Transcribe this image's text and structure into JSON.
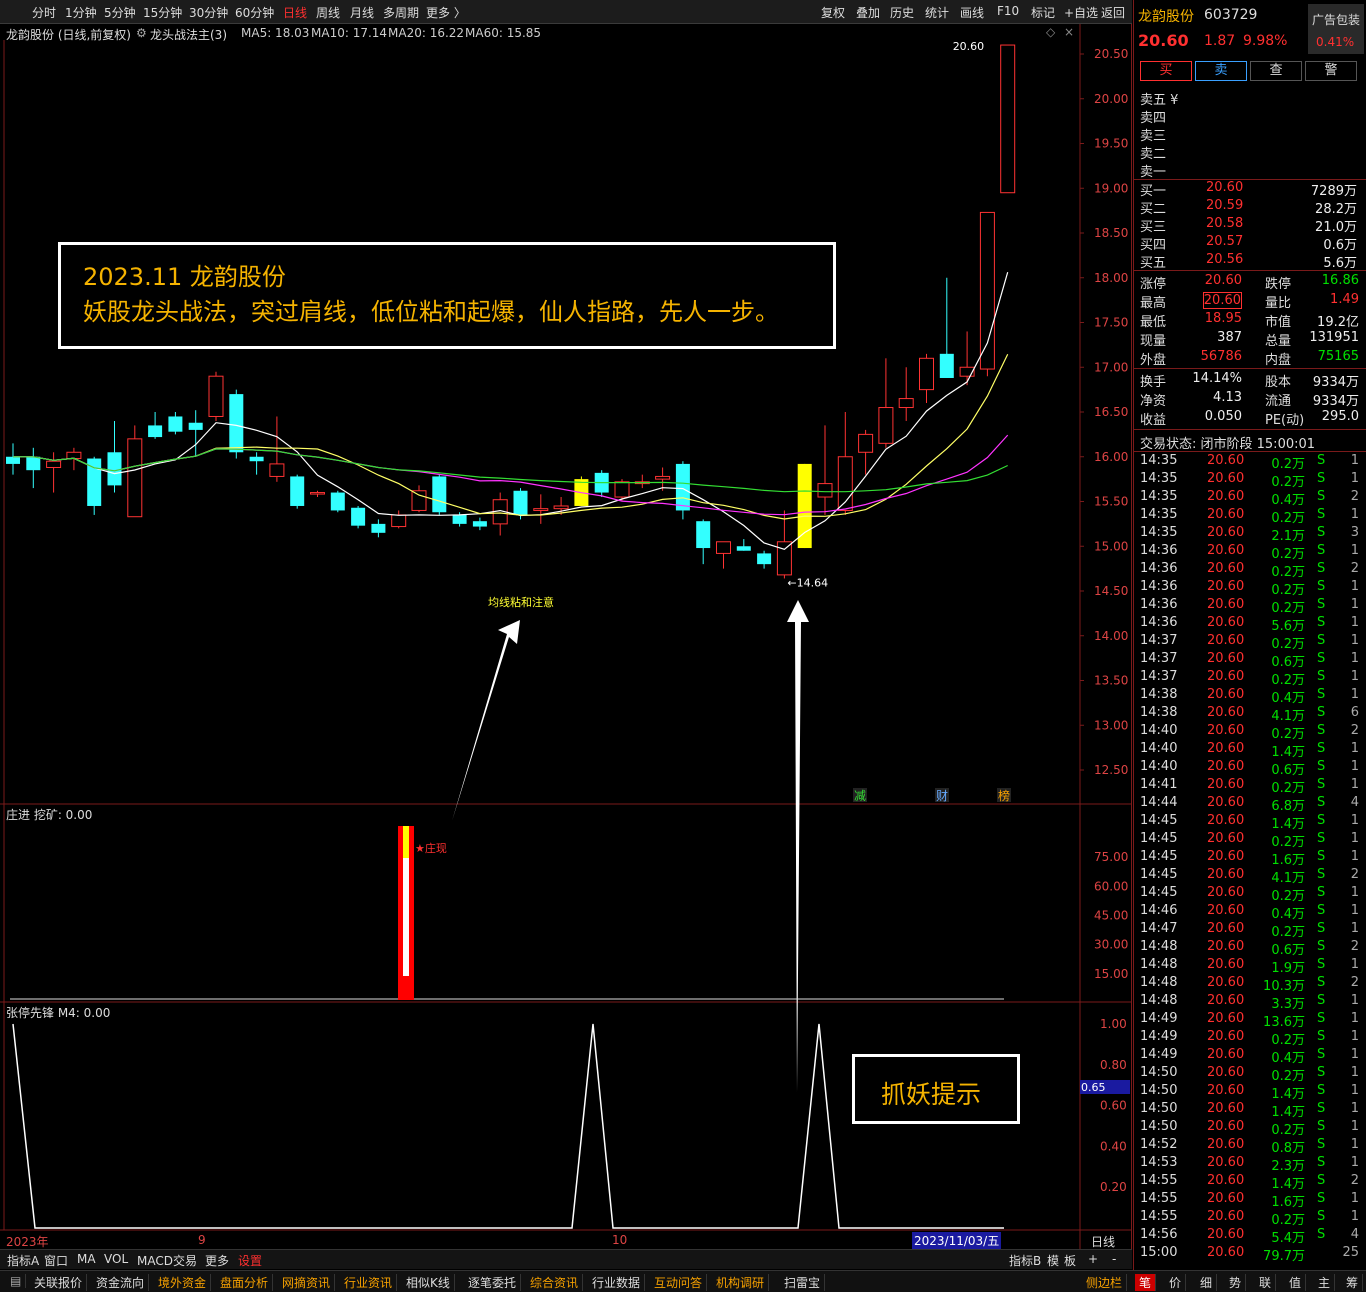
{
  "toolbar": {
    "periods": [
      "分时",
      "1分钟",
      "5分钟",
      "15分钟",
      "30分钟",
      "60分钟",
      "日线",
      "周线",
      "月线",
      "多周期",
      "更多 〉"
    ],
    "active_period": "日线",
    "tools": [
      "复权",
      "叠加",
      "历史",
      "统计",
      "画线",
      "F10",
      "标记",
      "+自选",
      "返回"
    ]
  },
  "chart": {
    "header_left": "龙韵股份 (日线,前复权)",
    "formula": "龙头战法主(3)",
    "ma": [
      {
        "label": "MA5: 18.03",
        "color": "#ffff33"
      },
      {
        "label": "MA10: 17.14",
        "color": "#ff33ff"
      },
      {
        "label": "MA20: 16.22",
        "color": "#33ff33"
      },
      {
        "label": "MA60: 15.85",
        "color": "#dddddd"
      }
    ],
    "price_ticks": [
      "20.50",
      "20.00",
      "19.50",
      "19.00",
      "18.50",
      "18.00",
      "17.50",
      "17.00",
      "16.50",
      "16.00",
      "15.50",
      "15.00",
      "14.50",
      "14.00",
      "13.50",
      "13.00",
      "12.50"
    ],
    "high_label": "20.60",
    "low_label": "←14.64",
    "ma_note": "均线粘和注意",
    "markers": [
      "减",
      "财",
      "榜"
    ],
    "sub1_title": "庄进  挖矿: 0.00",
    "sub1_ticks": [
      "75.00",
      "60.00",
      "45.00",
      "30.00",
      "15.00"
    ],
    "sub1_note": "★庄现",
    "sub2_title": "张停先锋  M4: 0.00",
    "sub2_ticks": [
      "1.00",
      "0.80",
      "0.60",
      "0.40",
      "0.20"
    ],
    "sub2_cursor": "0.65",
    "date_labels": [
      "2023年",
      "9",
      "10"
    ],
    "date_current": "2023/11/03/五",
    "period_label": "日线"
  },
  "annotation": {
    "line1": "2023.11 龙韵股份",
    "line2": "妖股龙头战法，突过肩线，低位粘和起爆，仙人指路，先人一步。"
  },
  "annotation2": "抓妖提示",
  "chart_data": {
    "type": "candlestick",
    "y_range": [
      12.3,
      20.7
    ],
    "candles": [
      {
        "o": 15.92,
        "h": 16.15,
        "l": 15.8,
        "c": 16.0,
        "color": "cyan"
      },
      {
        "o": 15.85,
        "h": 16.1,
        "l": 15.65,
        "c": 16.0,
        "color": "cyan"
      },
      {
        "o": 15.95,
        "h": 16.05,
        "l": 15.6,
        "c": 15.88,
        "color": "red"
      },
      {
        "o": 15.98,
        "h": 16.1,
        "l": 15.85,
        "c": 16.05,
        "color": "red"
      },
      {
        "o": 15.98,
        "h": 16.0,
        "l": 15.35,
        "c": 15.45,
        "color": "cyan"
      },
      {
        "o": 16.05,
        "h": 16.4,
        "l": 15.6,
        "c": 15.68,
        "color": "cyan"
      },
      {
        "o": 15.33,
        "h": 16.35,
        "l": 15.33,
        "c": 16.2,
        "color": "red"
      },
      {
        "o": 16.35,
        "h": 16.5,
        "l": 16.2,
        "c": 16.22,
        "color": "cyan"
      },
      {
        "o": 16.45,
        "h": 16.5,
        "l": 16.25,
        "c": 16.28,
        "color": "cyan"
      },
      {
        "o": 16.38,
        "h": 16.52,
        "l": 16.0,
        "c": 16.3,
        "color": "cyan"
      },
      {
        "o": 16.45,
        "h": 16.95,
        "l": 16.4,
        "c": 16.9,
        "color": "red"
      },
      {
        "o": 16.7,
        "h": 16.75,
        "l": 15.98,
        "c": 16.05,
        "color": "cyan"
      },
      {
        "o": 16.0,
        "h": 16.05,
        "l": 15.8,
        "c": 15.95,
        "color": "cyan"
      },
      {
        "o": 15.78,
        "h": 16.45,
        "l": 15.72,
        "c": 15.92,
        "color": "red"
      },
      {
        "o": 15.78,
        "h": 15.8,
        "l": 15.42,
        "c": 15.45,
        "color": "cyan"
      },
      {
        "o": 15.6,
        "h": 15.62,
        "l": 15.55,
        "c": 15.6,
        "color": "red"
      },
      {
        "o": 15.6,
        "h": 15.62,
        "l": 15.38,
        "c": 15.4,
        "color": "cyan"
      },
      {
        "o": 15.43,
        "h": 15.45,
        "l": 15.2,
        "c": 15.23,
        "color": "cyan"
      },
      {
        "o": 15.25,
        "h": 15.3,
        "l": 15.1,
        "c": 15.15,
        "color": "cyan"
      },
      {
        "o": 15.22,
        "h": 15.4,
        "l": 15.2,
        "c": 15.35,
        "color": "red"
      },
      {
        "o": 15.4,
        "h": 15.68,
        "l": 15.38,
        "c": 15.62,
        "color": "red"
      },
      {
        "o": 15.78,
        "h": 15.8,
        "l": 15.35,
        "c": 15.38,
        "color": "cyan"
      },
      {
        "o": 15.35,
        "h": 15.38,
        "l": 15.22,
        "c": 15.25,
        "color": "cyan"
      },
      {
        "o": 15.28,
        "h": 15.32,
        "l": 15.18,
        "c": 15.22,
        "color": "cyan"
      },
      {
        "o": 15.25,
        "h": 15.6,
        "l": 15.12,
        "c": 15.52,
        "color": "red"
      },
      {
        "o": 15.62,
        "h": 15.65,
        "l": 15.3,
        "c": 15.35,
        "color": "cyan"
      },
      {
        "o": 15.4,
        "h": 15.58,
        "l": 15.25,
        "c": 15.42,
        "color": "red"
      },
      {
        "o": 15.42,
        "h": 15.55,
        "l": 15.35,
        "c": 15.45,
        "color": "red"
      },
      {
        "o": 15.75,
        "h": 15.78,
        "l": 15.45,
        "c": 15.45,
        "color": "yellow"
      },
      {
        "o": 15.82,
        "h": 15.85,
        "l": 15.55,
        "c": 15.6,
        "color": "cyan"
      },
      {
        "o": 15.55,
        "h": 15.75,
        "l": 15.5,
        "c": 15.72,
        "color": "red"
      },
      {
        "o": 15.7,
        "h": 15.8,
        "l": 15.65,
        "c": 15.72,
        "color": "red"
      },
      {
        "o": 15.75,
        "h": 15.88,
        "l": 15.62,
        "c": 15.78,
        "color": "red"
      },
      {
        "o": 15.92,
        "h": 15.95,
        "l": 15.3,
        "c": 15.4,
        "color": "cyan"
      },
      {
        "o": 15.28,
        "h": 15.3,
        "l": 14.8,
        "c": 14.98,
        "color": "cyan"
      },
      {
        "o": 14.92,
        "h": 15.05,
        "l": 14.75,
        "c": 15.05,
        "color": "red"
      },
      {
        "o": 15.0,
        "h": 15.08,
        "l": 14.95,
        "c": 14.95,
        "color": "cyan"
      },
      {
        "o": 14.92,
        "h": 14.95,
        "l": 14.75,
        "c": 14.8,
        "color": "cyan"
      },
      {
        "o": 14.68,
        "h": 15.4,
        "l": 14.64,
        "c": 15.05,
        "color": "red"
      },
      {
        "o": 14.98,
        "h": 15.92,
        "l": 14.98,
        "c": 15.92,
        "color": "yellow"
      },
      {
        "o": 15.55,
        "h": 16.35,
        "l": 15.35,
        "c": 15.7,
        "color": "red"
      },
      {
        "o": 15.4,
        "h": 16.5,
        "l": 15.35,
        "c": 16.0,
        "color": "red"
      },
      {
        "o": 16.05,
        "h": 16.3,
        "l": 15.8,
        "c": 16.25,
        "color": "red"
      },
      {
        "o": 16.15,
        "h": 17.1,
        "l": 16.1,
        "c": 16.55,
        "color": "red"
      },
      {
        "o": 16.55,
        "h": 17.0,
        "l": 16.4,
        "c": 16.65,
        "color": "red"
      },
      {
        "o": 16.75,
        "h": 17.15,
        "l": 16.6,
        "c": 17.1,
        "color": "red"
      },
      {
        "o": 17.15,
        "h": 18.0,
        "l": 16.88,
        "c": 16.88,
        "color": "cyan"
      },
      {
        "o": 16.9,
        "h": 17.4,
        "l": 16.8,
        "c": 17.0,
        "color": "red"
      },
      {
        "o": 16.98,
        "h": 18.73,
        "l": 16.9,
        "c": 18.73,
        "color": "red"
      },
      {
        "o": 18.95,
        "h": 20.6,
        "l": 18.95,
        "c": 20.6,
        "color": "red"
      }
    ]
  },
  "quote": {
    "name": "龙韵股份",
    "code": "603729",
    "ad": "广告包装",
    "price": "20.60",
    "change": "1.87",
    "pct": "9.98%",
    "ad_pct": "0.41%",
    "buttons": [
      "买",
      "卖",
      "查",
      "警"
    ],
    "sell": [
      {
        "label": "卖五 ¥",
        "price": "",
        "vol": ""
      },
      {
        "label": "卖四",
        "price": "",
        "vol": ""
      },
      {
        "label": "卖三",
        "price": "",
        "vol": ""
      },
      {
        "label": "卖二",
        "price": "",
        "vol": ""
      },
      {
        "label": "卖一",
        "price": "",
        "vol": ""
      }
    ],
    "buy": [
      {
        "label": "买一",
        "price": "20.60",
        "vol": "7289万"
      },
      {
        "label": "买二",
        "price": "20.59",
        "vol": "28.2万"
      },
      {
        "label": "买三",
        "price": "20.58",
        "vol": "21.0万"
      },
      {
        "label": "买四",
        "price": "20.57",
        "vol": "0.6万"
      },
      {
        "label": "买五",
        "price": "20.56",
        "vol": "5.6万"
      }
    ],
    "stats": [
      {
        "l1": "涨停",
        "v1": "20.60",
        "c1": "red",
        "l2": "跌停",
        "v2": "16.86",
        "c2": "grn"
      },
      {
        "l1": "最高",
        "v1": "20.60",
        "c1": "red",
        "l2": "量比",
        "v2": "1.49",
        "c2": "red"
      },
      {
        "l1": "最低",
        "v1": "18.95",
        "c1": "red",
        "l2": "市值",
        "v2": "19.2亿",
        "c2": "wht"
      },
      {
        "l1": "现量",
        "v1": "387",
        "c1": "wht",
        "l2": "总量",
        "v2": "131951",
        "c2": "wht"
      },
      {
        "l1": "外盘",
        "v1": "56786",
        "c1": "red",
        "l2": "内盘",
        "v2": "75165",
        "c2": "grn"
      }
    ],
    "stats2": [
      {
        "l1": "换手",
        "v1": "14.14%",
        "l2": "股本",
        "v2": "9334万"
      },
      {
        "l1": "净资",
        "v1": "4.13",
        "l2": "流通",
        "v2": "9334万"
      },
      {
        "l1": "收益",
        "v1": "0.050",
        "l2": "PE(动)",
        "v2": "295.0"
      }
    ],
    "trade_status": "交易状态: 闭市阶段 15:00:01",
    "ticks": [
      [
        "14:35",
        "20.60",
        "0.2万",
        "S",
        "1"
      ],
      [
        "14:35",
        "20.60",
        "0.2万",
        "S",
        "1"
      ],
      [
        "14:35",
        "20.60",
        "0.4万",
        "S",
        "2"
      ],
      [
        "14:35",
        "20.60",
        "0.2万",
        "S",
        "1"
      ],
      [
        "14:35",
        "20.60",
        "2.1万",
        "S",
        "3"
      ],
      [
        "14:36",
        "20.60",
        "0.2万",
        "S",
        "1"
      ],
      [
        "14:36",
        "20.60",
        "0.2万",
        "S",
        "2"
      ],
      [
        "14:36",
        "20.60",
        "0.2万",
        "S",
        "1"
      ],
      [
        "14:36",
        "20.60",
        "0.2万",
        "S",
        "1"
      ],
      [
        "14:36",
        "20.60",
        "5.6万",
        "S",
        "1"
      ],
      [
        "14:37",
        "20.60",
        "0.2万",
        "S",
        "1"
      ],
      [
        "14:37",
        "20.60",
        "0.6万",
        "S",
        "1"
      ],
      [
        "14:37",
        "20.60",
        "0.2万",
        "S",
        "1"
      ],
      [
        "14:38",
        "20.60",
        "0.4万",
        "S",
        "1"
      ],
      [
        "14:38",
        "20.60",
        "4.1万",
        "S",
        "6"
      ],
      [
        "14:40",
        "20.60",
        "0.2万",
        "S",
        "2"
      ],
      [
        "14:40",
        "20.60",
        "1.4万",
        "S",
        "1"
      ],
      [
        "14:40",
        "20.60",
        "0.6万",
        "S",
        "1"
      ],
      [
        "14:41",
        "20.60",
        "0.2万",
        "S",
        "1"
      ],
      [
        "14:44",
        "20.60",
        "6.8万",
        "S",
        "4"
      ],
      [
        "14:45",
        "20.60",
        "1.4万",
        "S",
        "1"
      ],
      [
        "14:45",
        "20.60",
        "0.2万",
        "S",
        "1"
      ],
      [
        "14:45",
        "20.60",
        "1.6万",
        "S",
        "1"
      ],
      [
        "14:45",
        "20.60",
        "4.1万",
        "S",
        "2"
      ],
      [
        "14:45",
        "20.60",
        "0.2万",
        "S",
        "1"
      ],
      [
        "14:46",
        "20.60",
        "0.4万",
        "S",
        "1"
      ],
      [
        "14:47",
        "20.60",
        "0.2万",
        "S",
        "1"
      ],
      [
        "14:48",
        "20.60",
        "0.6万",
        "S",
        "2"
      ],
      [
        "14:48",
        "20.60",
        "1.9万",
        "S",
        "1"
      ],
      [
        "14:48",
        "20.60",
        "10.3万",
        "S",
        "2"
      ],
      [
        "14:48",
        "20.60",
        "3.3万",
        "S",
        "1"
      ],
      [
        "14:49",
        "20.60",
        "13.6万",
        "S",
        "1"
      ],
      [
        "14:49",
        "20.60",
        "0.2万",
        "S",
        "1"
      ],
      [
        "14:49",
        "20.60",
        "0.4万",
        "S",
        "1"
      ],
      [
        "14:50",
        "20.60",
        "0.2万",
        "S",
        "1"
      ],
      [
        "14:50",
        "20.60",
        "1.4万",
        "S",
        "1"
      ],
      [
        "14:50",
        "20.60",
        "1.4万",
        "S",
        "1"
      ],
      [
        "14:50",
        "20.60",
        "0.2万",
        "S",
        "1"
      ],
      [
        "14:52",
        "20.60",
        "0.8万",
        "S",
        "1"
      ],
      [
        "14:53",
        "20.60",
        "2.3万",
        "S",
        "1"
      ],
      [
        "14:55",
        "20.60",
        "1.4万",
        "S",
        "2"
      ],
      [
        "14:55",
        "20.60",
        "1.6万",
        "S",
        "1"
      ],
      [
        "14:55",
        "20.60",
        "0.2万",
        "S",
        "1"
      ],
      [
        "14:56",
        "20.60",
        "5.4万",
        "S",
        "4"
      ],
      [
        "15:00",
        "20.60",
        "79.7万",
        "",
        "25"
      ]
    ]
  },
  "bottom_tabs": {
    "row1_left": [
      "指标A",
      "窗口",
      "MA",
      "VOL",
      "MACD交易",
      "更多",
      "设置"
    ],
    "row1_right": [
      "指标B",
      "模",
      "板",
      "+",
      "-"
    ],
    "row2": [
      "关联报价",
      "资金流向",
      "境外资金",
      "盘面分析",
      "网摘资讯",
      "行业资讯",
      "相似K线",
      "逐笔委托",
      "综合资讯",
      "行业数据",
      "互动问答",
      "机构调研",
      "扫雷宝"
    ],
    "row2_orange": [
      2,
      3,
      4,
      5,
      8,
      10,
      11
    ],
    "row2_right": "侧边栏",
    "right_tabs": [
      "笔",
      "价",
      "细",
      "势",
      "联",
      "值",
      "主",
      "筹"
    ]
  }
}
